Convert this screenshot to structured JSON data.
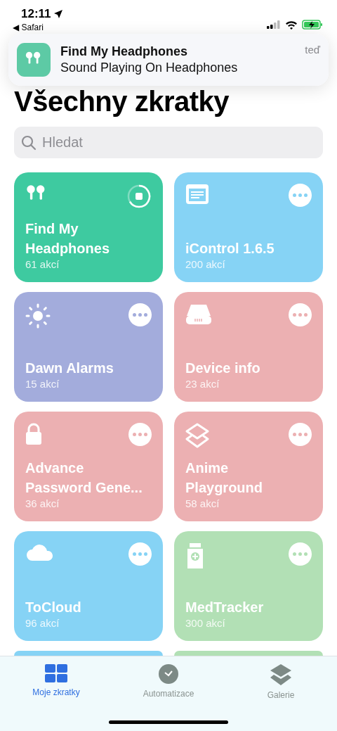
{
  "status_bar": {
    "time": "12:11",
    "back_app": "◀ Safari"
  },
  "notification": {
    "title": "Find My Headphones",
    "body": "Sound Playing On Headphones",
    "time": "teď"
  },
  "title": "Všechny zkratky",
  "search": {
    "placeholder": "Hledat"
  },
  "shortcuts": [
    {
      "name": "Find My Headphones",
      "actions": "61 akcí",
      "color": "#3ecaa0",
      "running": true
    },
    {
      "name": "iControl 1.6.5",
      "actions": "200 akcí",
      "color": "#86d3f5",
      "running": false
    },
    {
      "name": "Dawn Alarms",
      "actions": "15 akcí",
      "color": "#a3acdc",
      "running": false
    },
    {
      "name": "Device info",
      "actions": "23 akcí",
      "color": "#ecb0b2",
      "running": false
    },
    {
      "name": "Advance Password Gene...",
      "actions": "36 akcí",
      "color": "#ecb0b2",
      "running": false
    },
    {
      "name": "Anime Playground",
      "actions": "58 akcí",
      "color": "#ecb0b2",
      "running": false
    },
    {
      "name": "ToCloud",
      "actions": "96 akcí",
      "color": "#86d3f5",
      "running": false
    },
    {
      "name": "MedTracker",
      "actions": "300 akcí",
      "color": "#b2e0b5",
      "running": false
    },
    {
      "color": "#86d3f5"
    },
    {
      "color": "#b2e0b5"
    }
  ],
  "tabs": [
    {
      "label": "Moje zkratky",
      "selected": true
    },
    {
      "label": "Automatizace",
      "selected": false
    },
    {
      "label": "Galerie",
      "selected": false
    }
  ]
}
